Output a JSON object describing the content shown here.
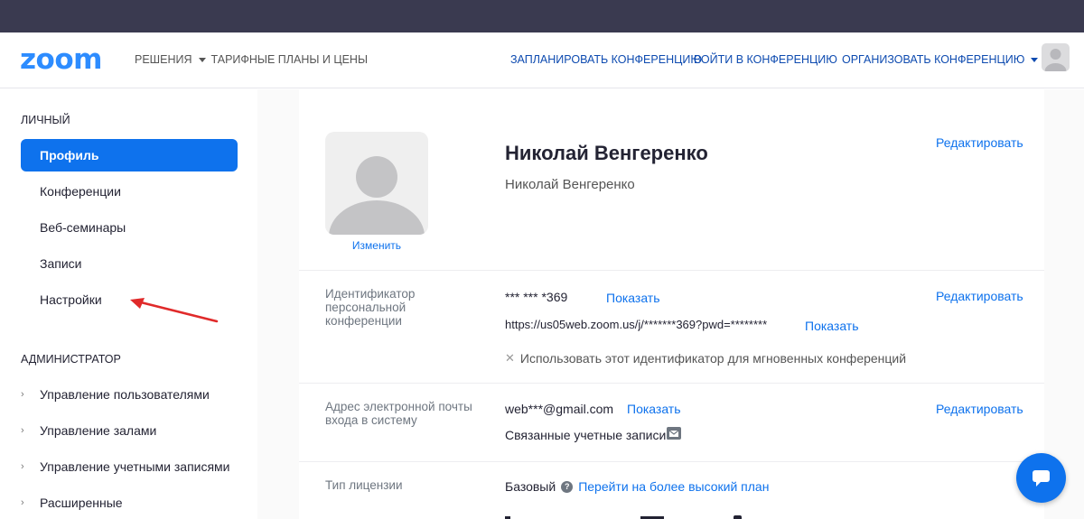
{
  "brand": {
    "logo": "zoom"
  },
  "nav": {
    "solutions": "РЕШЕНИЯ",
    "plans": "ТАРИФНЫЕ ПЛАНЫ И ЦЕНЫ",
    "schedule": "ЗАПЛАНИРОВАТЬ КОНФЕРЕНЦИЮ",
    "join": "ВОЙТИ В КОНФЕРЕНЦИЮ",
    "host": "ОРГАНИЗОВАТЬ КОНФЕРЕНЦИЮ"
  },
  "sidebar": {
    "personal_title": "ЛИЧНЫЙ",
    "items": [
      {
        "label": "Профиль",
        "active": true
      },
      {
        "label": "Конференции",
        "active": false
      },
      {
        "label": "Веб-семинары",
        "active": false
      },
      {
        "label": "Записи",
        "active": false
      },
      {
        "label": "Настройки",
        "active": false
      }
    ],
    "admin_title": "АДМИНИСТРАТОР",
    "admin_items": [
      {
        "label": "Управление пользователями"
      },
      {
        "label": "Управление залами"
      },
      {
        "label": "Управление учетными записями"
      },
      {
        "label": "Расширенные"
      }
    ]
  },
  "profile": {
    "change_photo": "Изменить",
    "display_name": "Николай Венгеренко",
    "full_name": "Николай Венгеренко",
    "edit": "Редактировать",
    "pmi": {
      "label": "Идентификатор персональной конференции",
      "value": "*** *** *369",
      "show": "Показать",
      "url": "https://us05web.zoom.us/j/*******369?pwd=********",
      "url_show": "Показать",
      "instant_option": "Использовать этот идентификатор для мгновенных конференций"
    },
    "email": {
      "label": "Адрес электронной почты входа в систему",
      "value": "web***@gmail.com",
      "show": "Показать",
      "linked_accounts": "Связанные учетные записи:"
    },
    "license": {
      "label": "Тип лицензии",
      "value": "Базовый",
      "upgrade": "Перейти на более высокий план"
    }
  },
  "colors": {
    "accent": "#0e72ed",
    "nav_link": "#0e4bb0",
    "annotation_arrow": "#e02a2a"
  }
}
